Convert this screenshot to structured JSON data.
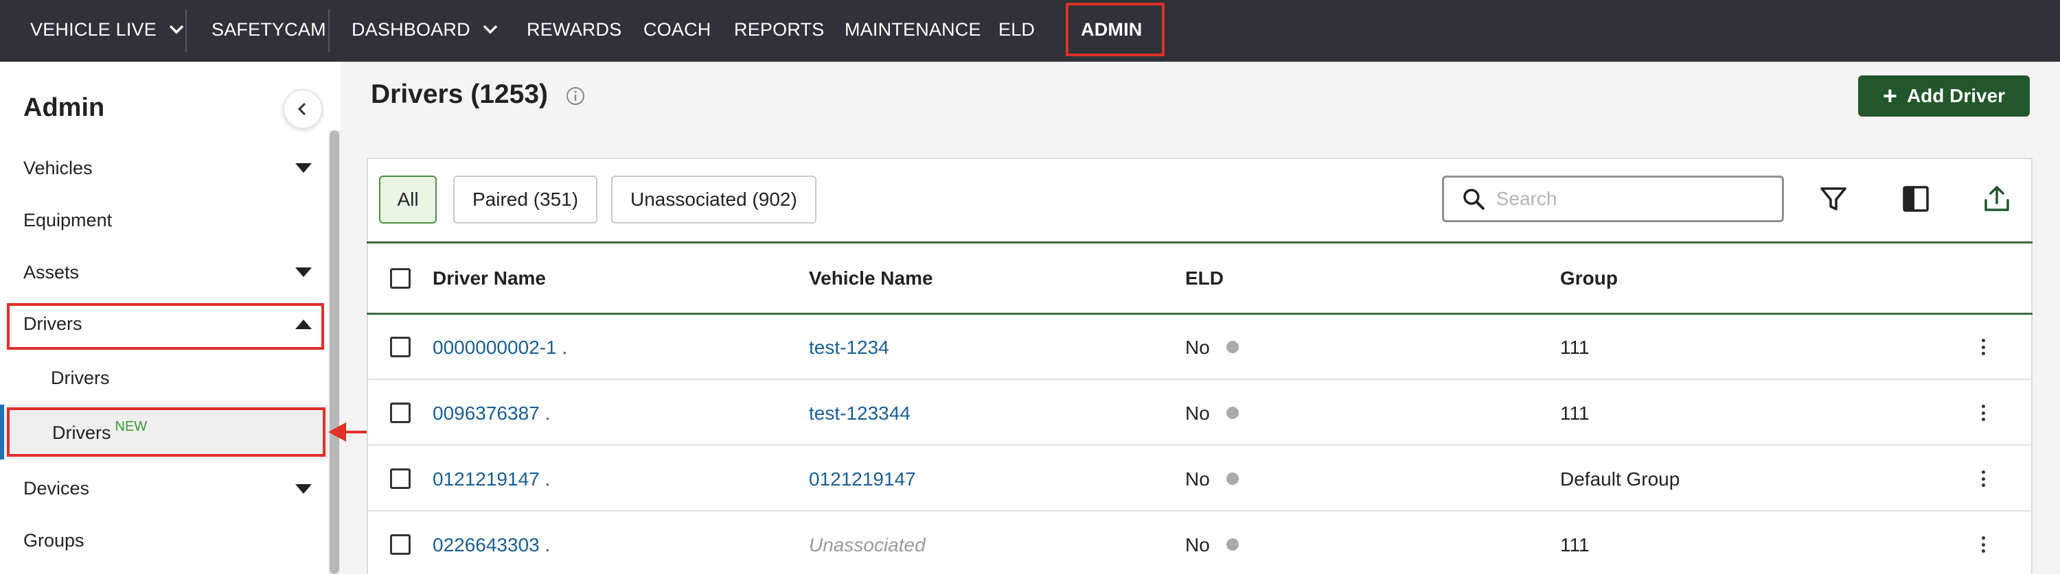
{
  "topnav": {
    "items": [
      {
        "label": "VEHICLE LIVE"
      },
      {
        "label": "SAFETYCAM"
      },
      {
        "label": "DASHBOARD"
      },
      {
        "label": "REWARDS"
      },
      {
        "label": "COACH"
      },
      {
        "label": "REPORTS"
      },
      {
        "label": "MAINTENANCE"
      },
      {
        "label": "ELD"
      },
      {
        "label": "ADMIN"
      }
    ]
  },
  "sidebar": {
    "title": "Admin",
    "items": [
      {
        "label": "Vehicles"
      },
      {
        "label": "Equipment"
      },
      {
        "label": "Assets"
      },
      {
        "label": "Drivers"
      },
      {
        "label": "Drivers"
      },
      {
        "label": "Drivers",
        "badge": "NEW"
      },
      {
        "label": "Devices"
      },
      {
        "label": "Groups"
      }
    ]
  },
  "main": {
    "title": "Drivers (1253)",
    "add_button": "Add Driver",
    "filters": [
      {
        "label": "All",
        "active": true
      },
      {
        "label": "Paired (351)"
      },
      {
        "label": "Unassociated (902)"
      }
    ],
    "search": {
      "placeholder": "Search",
      "value": ""
    }
  },
  "table": {
    "headers": [
      "Driver Name",
      "Vehicle Name",
      "ELD",
      "Group"
    ],
    "rows": [
      {
        "driver": "0000000002-1 .",
        "vehicle": "test-1234",
        "eld": "No",
        "group": "111"
      },
      {
        "driver": "0096376387 .",
        "vehicle": "test-123344",
        "eld": "No",
        "group": "111"
      },
      {
        "driver": "0121219147 .",
        "vehicle": "0121219147",
        "eld": "No",
        "group": "Default Group"
      },
      {
        "driver": "0226643303 .",
        "vehicle": "Unassociated",
        "eld": "No",
        "group": "111"
      }
    ]
  },
  "colors": {
    "nav_bg": "#2f3238",
    "accent_green": "#22572b",
    "link_blue": "#1a5e94",
    "highlight_red": "#e0302a",
    "new_badge_green": "#3a9c2f"
  }
}
